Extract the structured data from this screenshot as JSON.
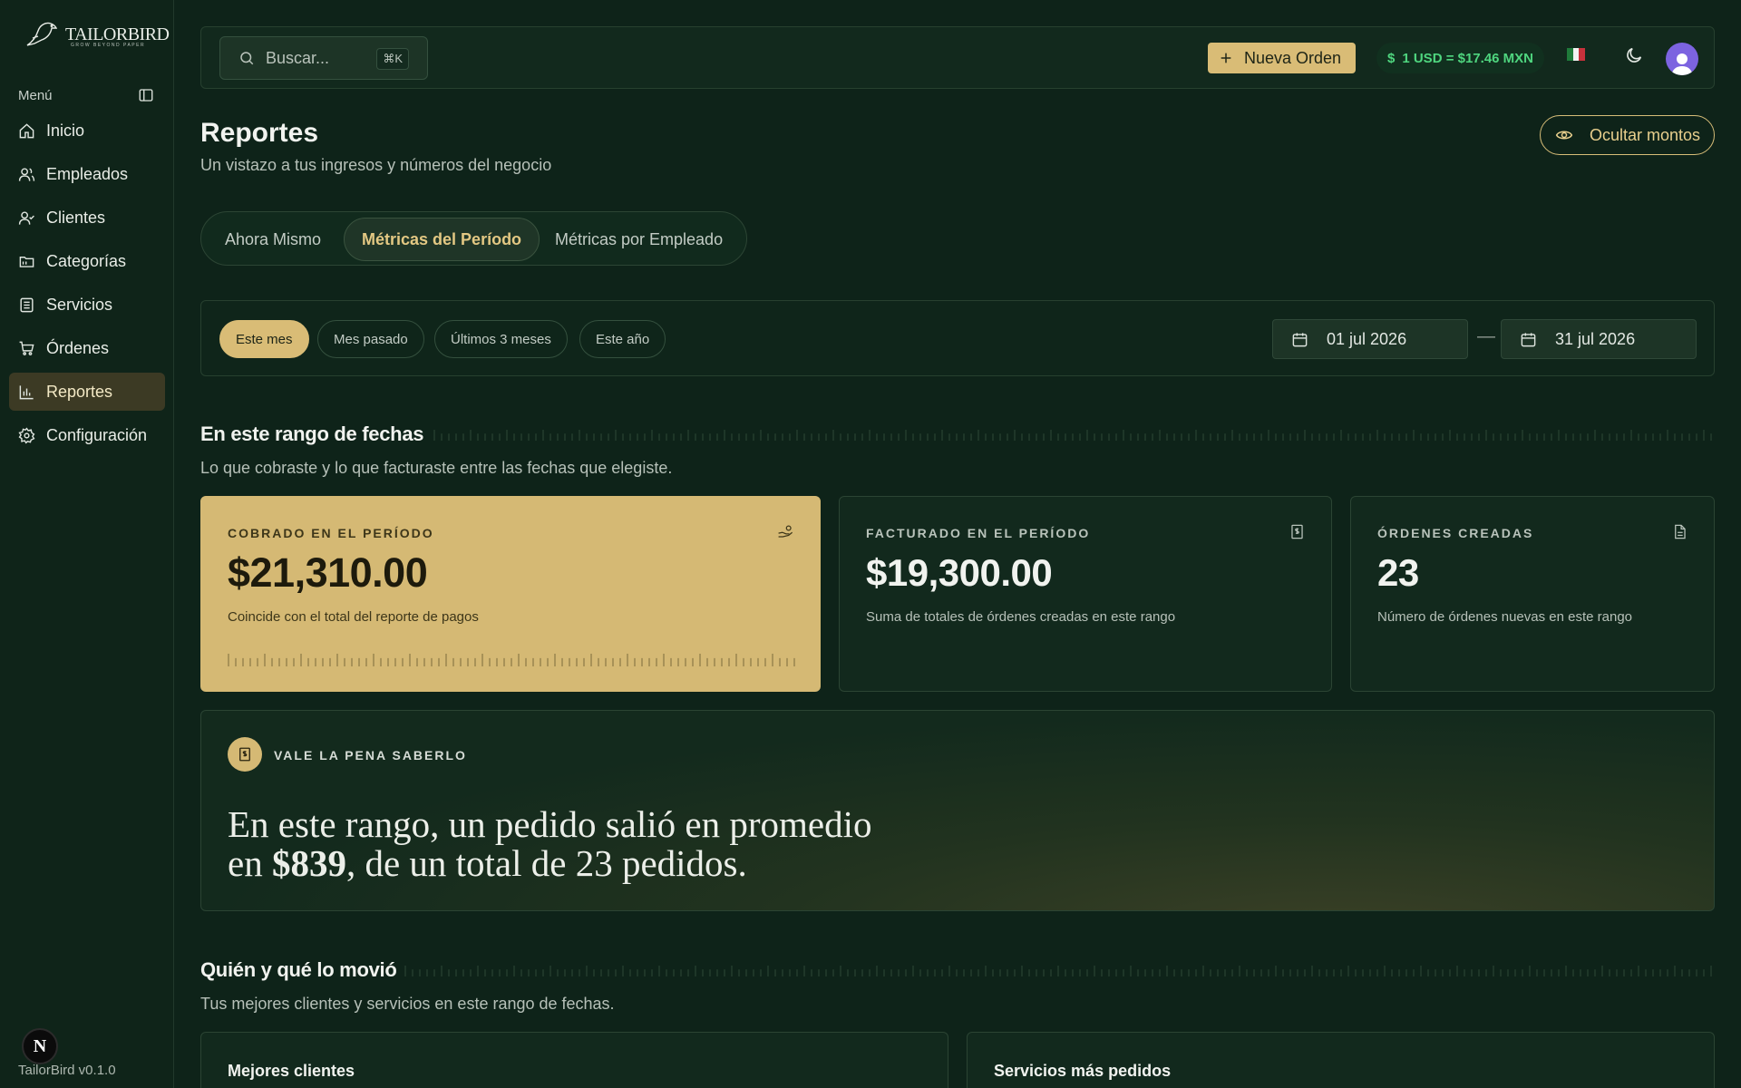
{
  "sidebar": {
    "logo_text": "TAILORBIRD",
    "logo_tagline": "GROW BEYOND PAPER",
    "menu_label": "Menú",
    "items": [
      {
        "label": "Inicio",
        "icon": "home-icon"
      },
      {
        "label": "Empleados",
        "icon": "users-icon"
      },
      {
        "label": "Clientes",
        "icon": "user-check-icon"
      },
      {
        "label": "Categorías",
        "icon": "folder-icon"
      },
      {
        "label": "Servicios",
        "icon": "list-icon"
      },
      {
        "label": "Órdenes",
        "icon": "cart-icon"
      },
      {
        "label": "Reportes",
        "icon": "bar-chart-icon",
        "active": true
      },
      {
        "label": "Configuración",
        "icon": "gear-icon"
      }
    ],
    "version": "TailorBird v0.1.0",
    "badge": "N"
  },
  "topbar": {
    "search_placeholder": "Buscar...",
    "search_shortcut": "⌘K",
    "new_order_label": "Nueva Orden",
    "exchange_rate": "1 USD = $17.46 MXN",
    "currency_symbol": "$"
  },
  "header": {
    "title": "Reportes",
    "subtitle": "Un vistazo a tus ingresos y números del negocio",
    "hide_amounts_label": "Ocultar montos"
  },
  "tabs": [
    {
      "label": "Ahora Mismo"
    },
    {
      "label": "Métricas del Período",
      "active": true
    },
    {
      "label": "Métricas por Empleado"
    }
  ],
  "filters": {
    "chips": [
      "Este mes",
      "Mes pasado",
      "Últimos 3 meses",
      "Este año"
    ],
    "active_chip": "Este mes",
    "date_from": "01 jul 2026",
    "date_to": "31 jul 2026",
    "separator": "—"
  },
  "range_section": {
    "title": "En este rango de fechas",
    "subtitle": "Lo que cobraste y lo que facturaste entre las fechas que elegiste."
  },
  "cards": [
    {
      "label": "COBRADO EN EL PERÍODO",
      "value": "$21,310.00",
      "note": "Coincide con el total del reporte de pagos",
      "icon": "hand-coins-icon"
    },
    {
      "label": "FACTURADO EN EL PERÍODO",
      "value": "$19,300.00",
      "note": "Suma de totales de órdenes creadas en este rango",
      "icon": "receipt-icon"
    },
    {
      "label": "ÓRDENES CREADAS",
      "value": "23",
      "note": "Número de órdenes nuevas en este rango",
      "icon": "file-icon"
    }
  ],
  "insight": {
    "label": "VALE LA PENA SABERLO",
    "line1": "En este rango, un pedido salió en promedio",
    "line2_prefix": "en ",
    "amount": "$839",
    "line2_suffix": ", de un total de 23 pedidos."
  },
  "movers_section": {
    "title": "Quién y qué lo movió",
    "subtitle": "Tus mejores clientes y servicios en este rango de fechas."
  },
  "bottom_cards": [
    "Mejores clientes",
    "Servicios más pedidos"
  ],
  "colors": {
    "background": "#0e2319",
    "accent_gold": "#d9bc76",
    "rate_green": "#4fd67f"
  }
}
